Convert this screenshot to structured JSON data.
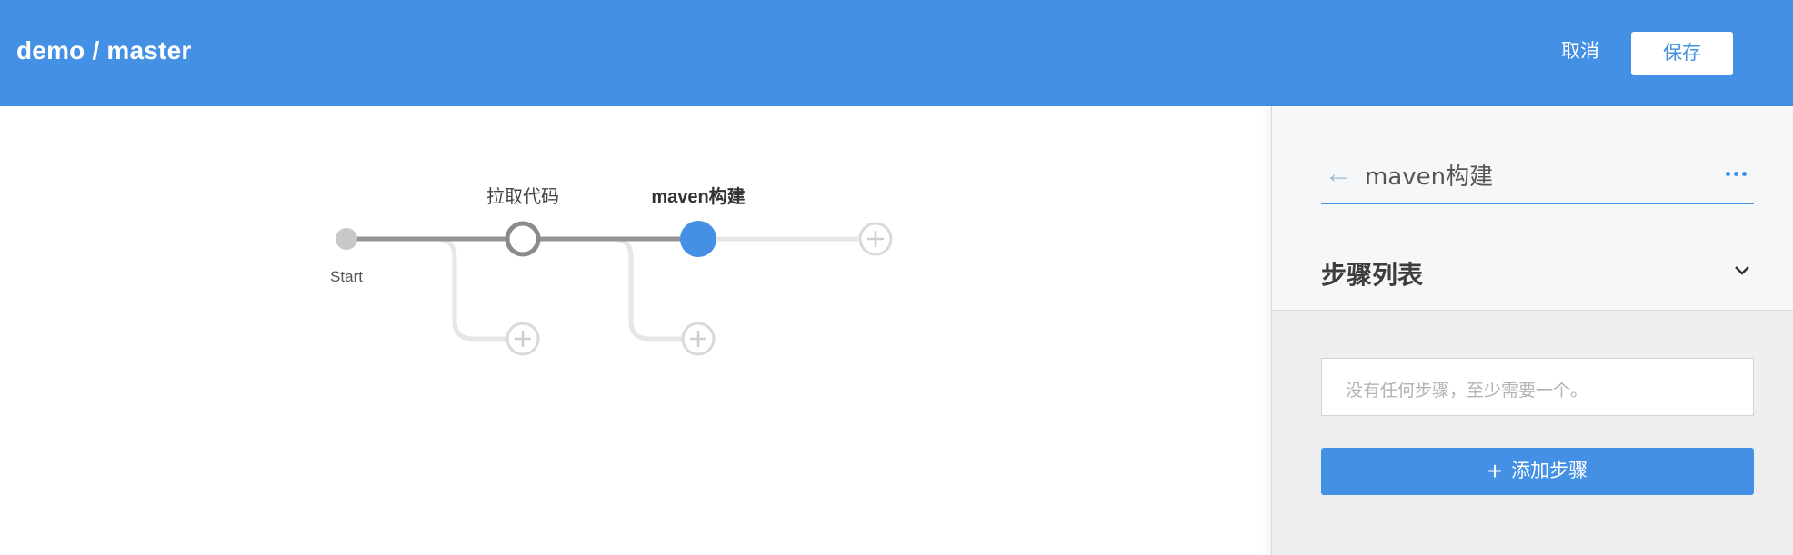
{
  "header": {
    "title": "demo / master",
    "cancel_label": "取消",
    "save_label": "保存",
    "brand_color": "#4390e5"
  },
  "pipeline": {
    "start_label": "Start",
    "stages": [
      {
        "label": "拉取代码",
        "selected": false
      },
      {
        "label": "maven构建",
        "selected": true
      }
    ],
    "icons": {
      "add_stage": "plus-circle-icon",
      "add_parallel": "plus-circle-icon"
    }
  },
  "panel": {
    "stage_name": "maven构建",
    "back_icon": "arrow-left-icon",
    "more_icon": "more-horizontal-icon",
    "steps_title": "步骤列表",
    "steps_chevron_icon": "chevron-down-icon",
    "empty_text": "没有任何步骤，至少需要一个。",
    "add_step_icon": "plus-icon",
    "add_step_label": "添加步骤"
  }
}
